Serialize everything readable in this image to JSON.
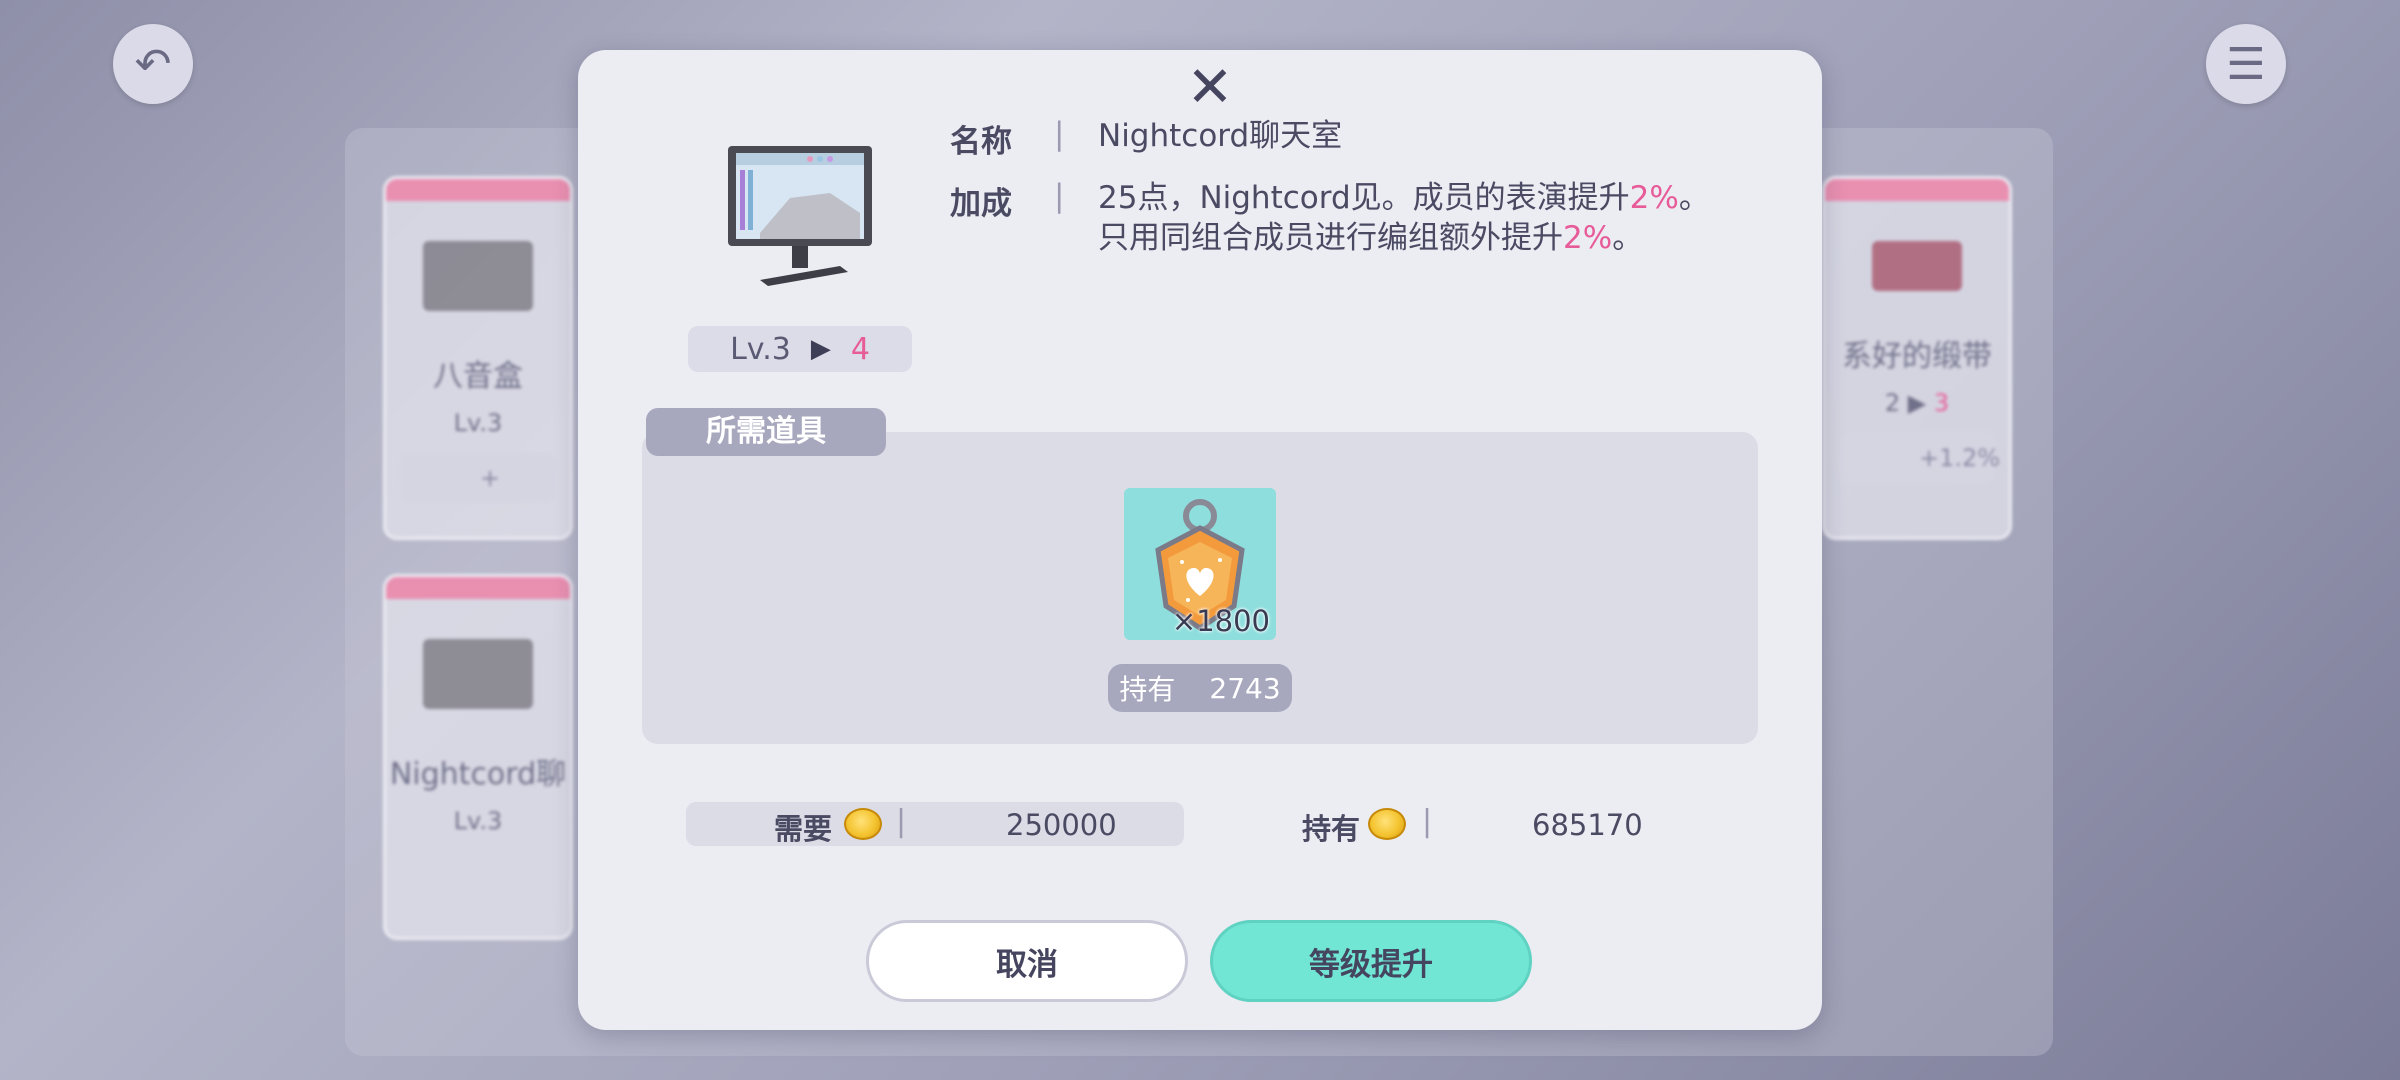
{
  "dialog": {
    "item": {
      "name_label": "名称",
      "name_value": "Nightcord聊天室",
      "bonus_label": "加成",
      "bonus_line1_prefix": "25点，Nightcord见。成员的表演提升",
      "bonus_line1_pct": "2%",
      "bonus_line1_suffix": "。",
      "bonus_line2_prefix": "只用同组合成员进行编组额外提升",
      "bonus_line2_pct": "2%",
      "bonus_line2_suffix": "。",
      "separator": "|",
      "level_current": "Lv.3",
      "level_next": "4",
      "level_arrow": "▶",
      "icon": "monitor-icon"
    },
    "required": {
      "tab_label": "所需道具",
      "material_icon": "heart-charm-icon",
      "material_qty": "×1800",
      "owned_label": "持有",
      "owned_value": "2743"
    },
    "coins": {
      "need_label": "需要",
      "need_value": "250000",
      "have_label": "持有",
      "have_value": "685170",
      "icon": "coin-icon"
    },
    "buttons": {
      "cancel": "取消",
      "upgrade": "等级提升"
    },
    "close": "✕"
  },
  "background": {
    "cards": [
      {
        "name": "八音盒",
        "level": "Lv.3",
        "bonus": "+"
      },
      {
        "name": "系好的缎带",
        "level": "2",
        "next": "3",
        "bonus": "+1.2%"
      },
      {
        "name": "Nightcord聊",
        "level": "Lv.3"
      }
    ],
    "back_icon": "back-arrow-icon",
    "menu_icon": "menu-icon"
  },
  "colors": {
    "accent_pink": "#e75b98",
    "upgrade_teal": "#71e6d5",
    "dialog_bg": "#ececf3"
  }
}
